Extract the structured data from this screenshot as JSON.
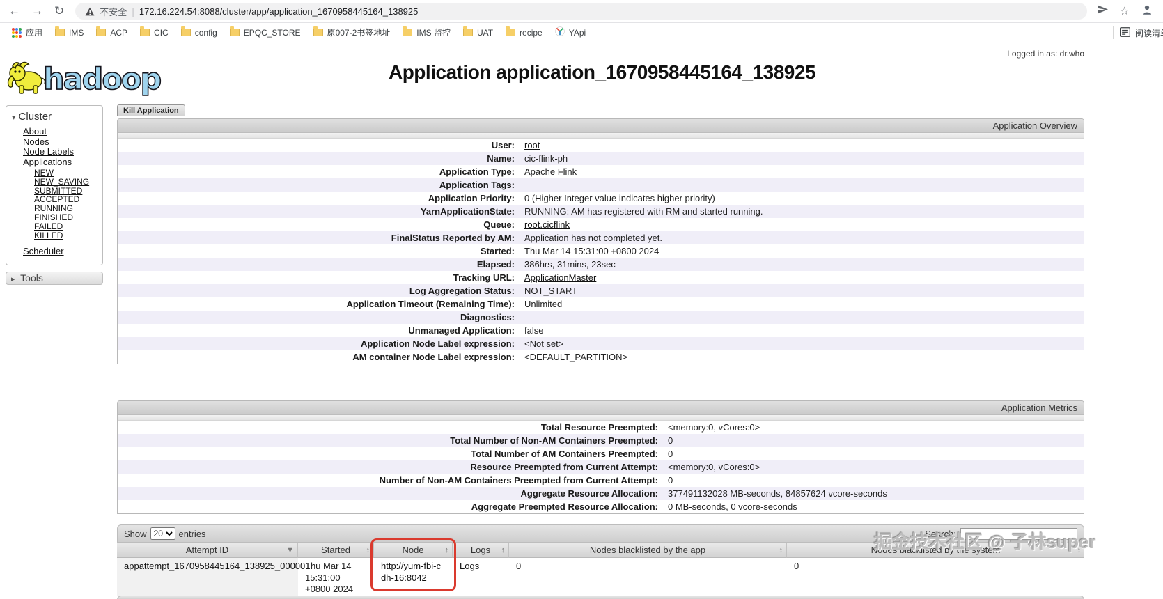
{
  "icons": {
    "back": "←",
    "forward": "→",
    "reload": "↻",
    "star": "☆",
    "sort": "↕",
    "sorted_desc": "▼",
    "cluster_expanded": "▾",
    "tools_collapsed": "▸"
  },
  "browser": {
    "security_label": "不安全",
    "url": "172.16.224.54:8088/cluster/app/application_1670958445164_138925",
    "apps_label": "应用",
    "bookmarks": [
      "IMS",
      "ACP",
      "CIC",
      "config",
      "EPQC_STORE",
      "原007-2书签地址",
      "IMS 监控",
      "UAT",
      "recipe",
      "YApi"
    ],
    "reading_list_label": "阅读清单"
  },
  "header": {
    "logo_text": "hadoop",
    "title": "Application application_1670958445164_138925",
    "logged_in": "Logged in as: dr.who"
  },
  "sidebar": {
    "cluster_title": "Cluster",
    "links": [
      "About",
      "Nodes",
      "Node Labels",
      "Applications"
    ],
    "states": [
      "NEW",
      "NEW_SAVING",
      "SUBMITTED",
      "ACCEPTED",
      "RUNNING",
      "FINISHED",
      "FAILED",
      "KILLED"
    ],
    "scheduler_label": "Scheduler",
    "tools_title": "Tools"
  },
  "main": {
    "kill_button": "Kill Application",
    "overview": {
      "title": "Application Overview",
      "rows": [
        {
          "label": "User:",
          "value": "root"
        },
        {
          "label": "Name:",
          "value": "cic-flink-ph"
        },
        {
          "label": "Application Type:",
          "value": "Apache Flink"
        },
        {
          "label": "Application Tags:",
          "value": ""
        },
        {
          "label": "Application Priority:",
          "value": "0 (Higher Integer value indicates higher priority)"
        },
        {
          "label": "YarnApplicationState:",
          "value": "RUNNING: AM has registered with RM and started running."
        },
        {
          "label": "Queue:",
          "value": "root.cicflink"
        },
        {
          "label": "FinalStatus Reported by AM:",
          "value": "Application has not completed yet."
        },
        {
          "label": "Started:",
          "value": "Thu Mar 14 15:31:00 +0800 2024"
        },
        {
          "label": "Elapsed:",
          "value": "386hrs, 31mins, 23sec"
        },
        {
          "label": "Tracking URL:",
          "value": "ApplicationMaster"
        },
        {
          "label": "Log Aggregation Status:",
          "value": "NOT_START"
        },
        {
          "label": "Application Timeout (Remaining Time):",
          "value": "Unlimited"
        },
        {
          "label": "Diagnostics:",
          "value": ""
        },
        {
          "label": "Unmanaged Application:",
          "value": "false"
        },
        {
          "label": "Application Node Label expression:",
          "value": "<Not set>"
        },
        {
          "label": "AM container Node Label expression:",
          "value": "<DEFAULT_PARTITION>"
        }
      ]
    },
    "metrics": {
      "title": "Application Metrics",
      "rows": [
        {
          "label": "Total Resource Preempted:",
          "value": "<memory:0, vCores:0>"
        },
        {
          "label": "Total Number of Non-AM Containers Preempted:",
          "value": "0"
        },
        {
          "label": "Total Number of AM Containers Preempted:",
          "value": "0"
        },
        {
          "label": "Resource Preempted from Current Attempt:",
          "value": "<memory:0, vCores:0>"
        },
        {
          "label": "Number of Non-AM Containers Preempted from Current Attempt:",
          "value": "0"
        },
        {
          "label": "Aggregate Resource Allocation:",
          "value": "377491132028 MB-seconds, 84857624 vcore-seconds"
        },
        {
          "label": "Aggregate Preempted Resource Allocation:",
          "value": "0 MB-seconds, 0 vcore-seconds"
        }
      ]
    },
    "attempts_table": {
      "show_label": "Show",
      "page_size": "20",
      "entries_label": "entries",
      "search_label": "Search:",
      "columns": [
        "Attempt ID",
        "Started",
        "Node",
        "Logs",
        "Nodes blacklisted by the app",
        "Nodes blacklisted by the system"
      ],
      "row": {
        "attempt_id": "appattempt_1670958445164_138925_000001",
        "started": "Thu Mar 14 15:31:00 +0800 2024",
        "node": "http://yum-fbi-cdh-16:8042",
        "logs": "Logs",
        "blacklisted_by_app": "0",
        "blacklisted_by_system": "0"
      }
    }
  },
  "watermark": "掘金技术社区 @ 子林super"
}
